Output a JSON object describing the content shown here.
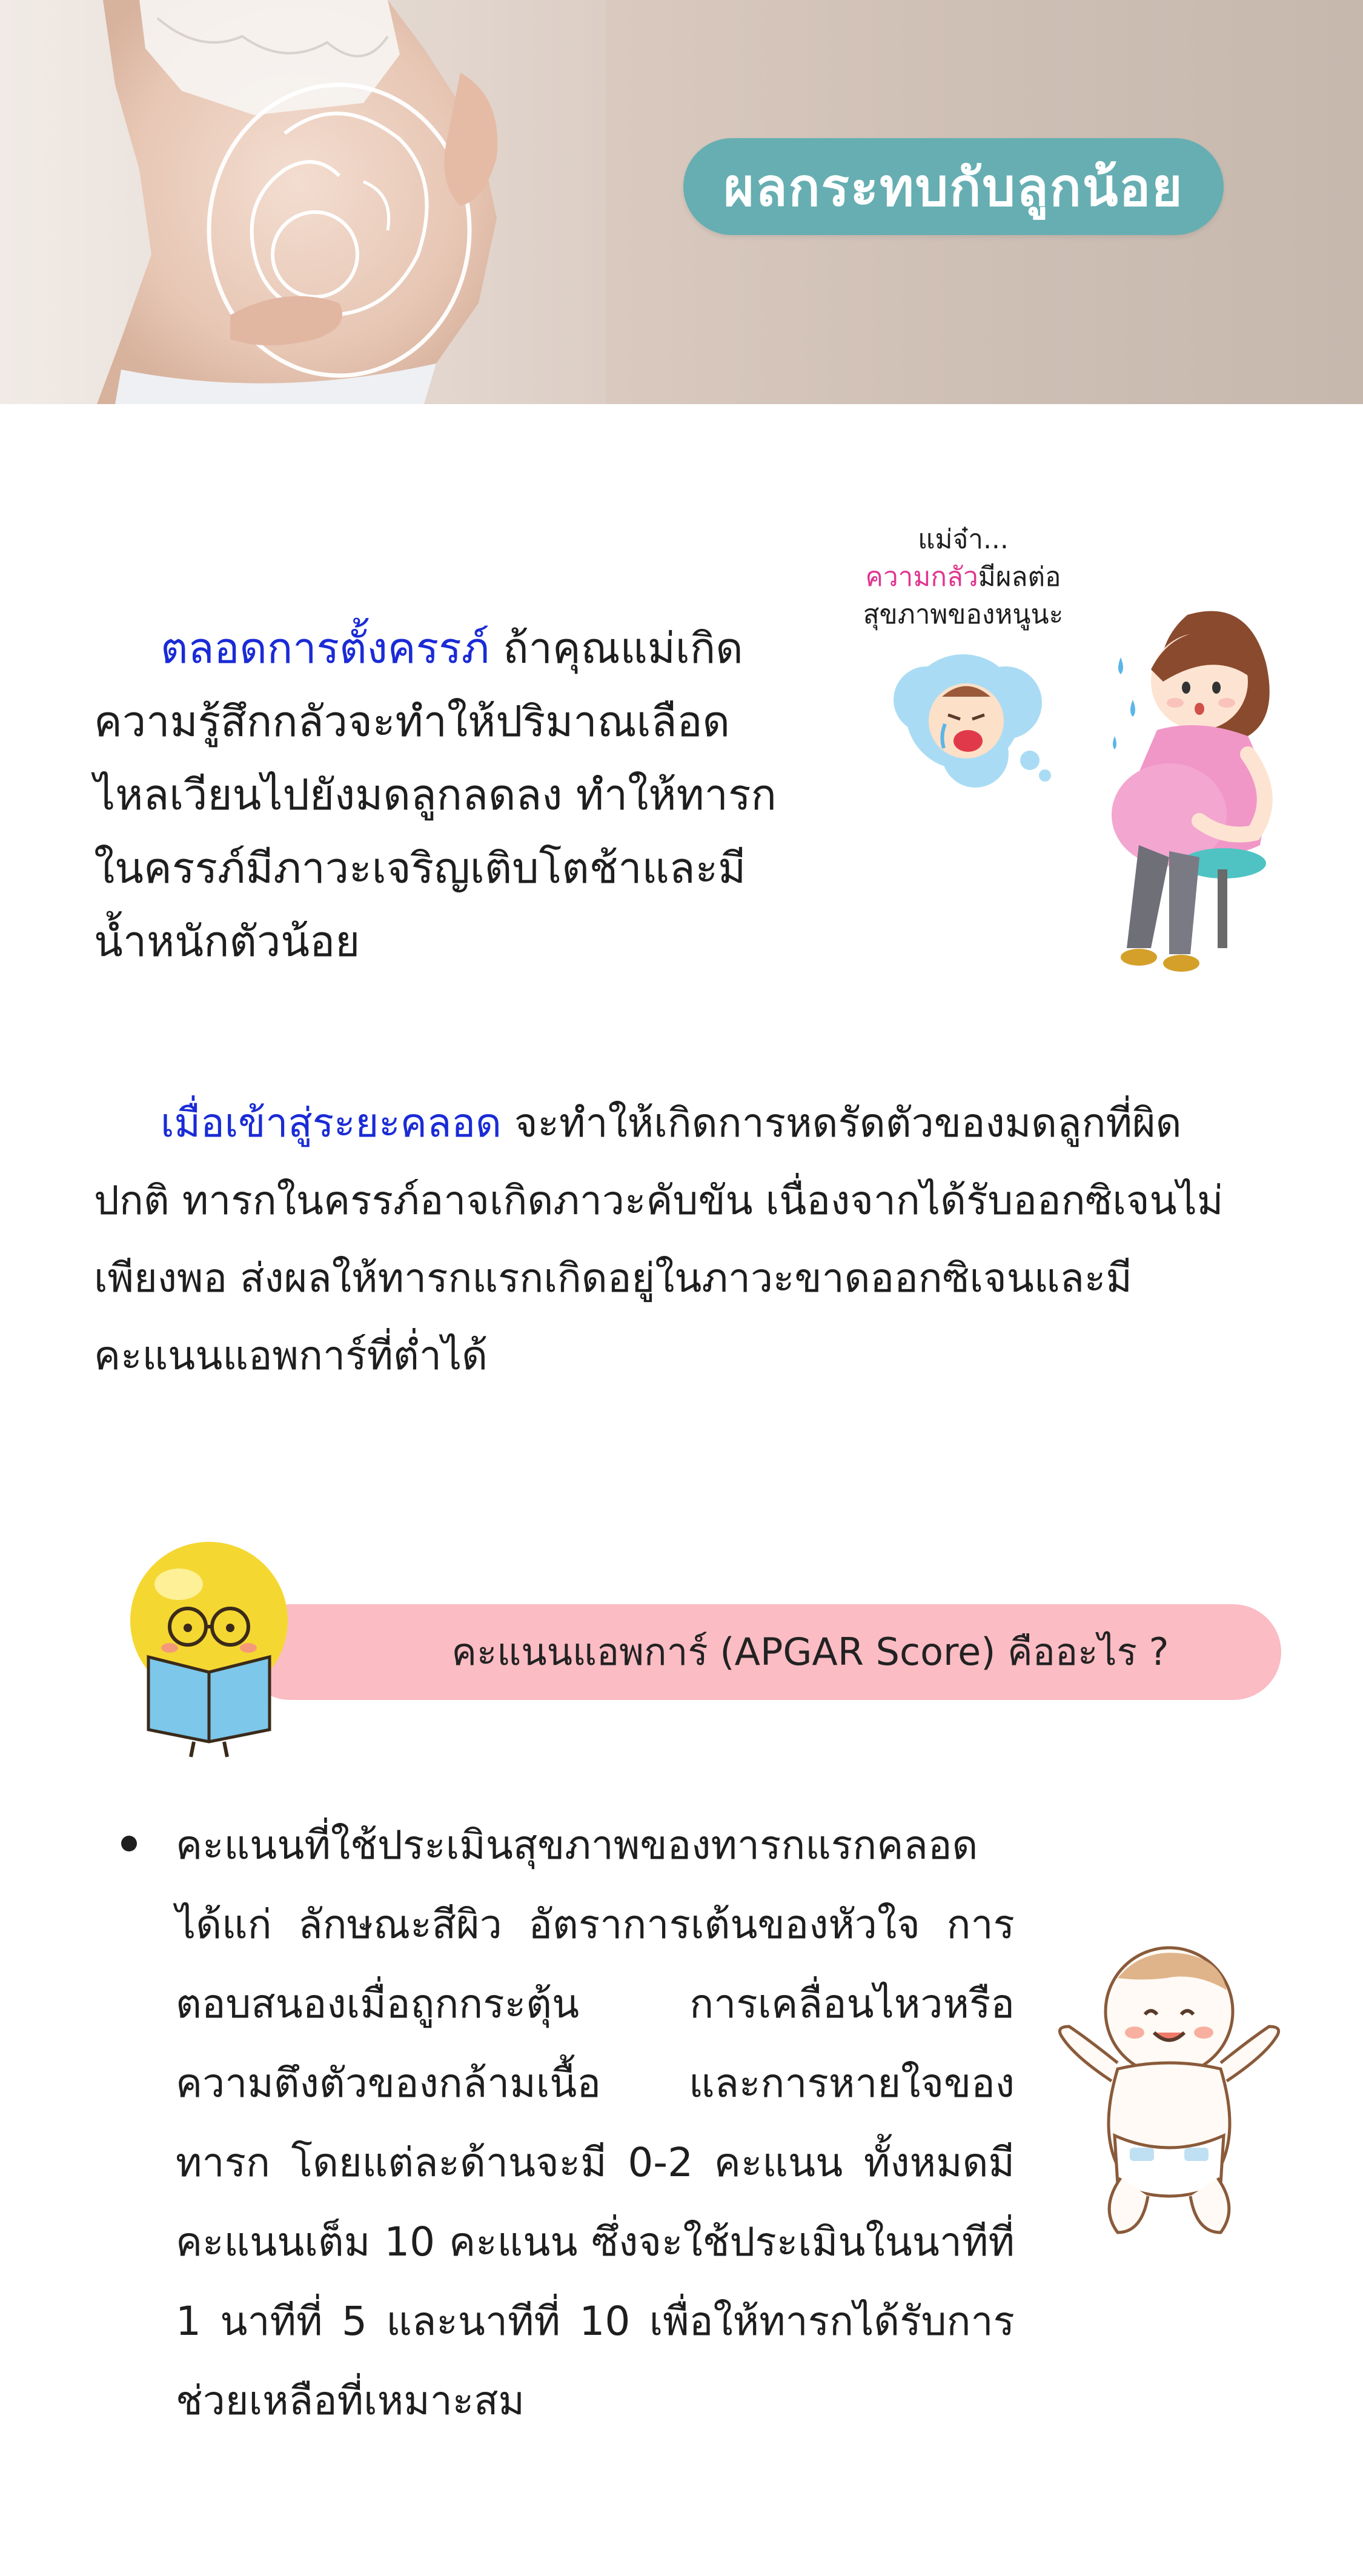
{
  "hero": {
    "title": "ผลกระทบกับลูกน้อย",
    "pill_color": "#66aeb2"
  },
  "section1": {
    "lead": "ตลอดการตั้งครรภ์",
    "text": " ถ้าคุณแม่เกิดความรู้สึกกลัวจะทำให้ปริมาณเลือดไหลเวียนไปยังมดลูกลดลง ทำให้ทารกในครรภ์มีภาวะเจริญเติบโตช้าและมีน้ำหนักตัวน้อย",
    "note": {
      "line1": "แม่จ๋า...",
      "highlight": "ความกลัว",
      "line2_rest": "มีผลต่อ",
      "line3": "สุขภาพของหนูนะ"
    }
  },
  "section2": {
    "lead": "เมื่อเข้าสู่ระยะคลอด",
    "text": " จะทำให้เกิดการหดรัดตัวของมดลูกที่ผิดปกติ ทารกในครรภ์อาจเกิดภาวะคับขัน เนื่องจากได้รับออกซิเจนไม่เพียงพอ ส่งผลให้ทารกแรกเกิดอยู่ในภาวะขาดออกซิเจนและมีคะแนนแอพการ์ที่ต่ำได้"
  },
  "section3": {
    "heading": "คะแนนแอพการ์ (APGAR Score) คืออะไร ?",
    "pill_color": "#fbbcc4",
    "bullet": "คะแนนที่ใช้ประเมินสุขภาพของทารกแรกคลอด ได้แก่ ลักษณะสีผิว อัตราการเต้นของหัวใจ การตอบสนองเมื่อถูกกระตุ้น การเคลื่อนไหวหรือความตึงตัวของกล้ามเนื้อ และการหายใจของทารก โดยแต่ละด้านจะมี 0-2 คะแนน ทั้งหมดมีคะแนนเต็ม 10 คะแนน ซึ่งจะใช้ประเมินในนาทีที่ 1 นาทีที่ 5 และนาทีที่ 10 เพื่อให้ทารกได้รับการช่วยเหลือที่เหมาะสม"
  },
  "accent_blue": "#1a2bd6",
  "accent_pink": "#e0368f",
  "icons": [
    "pregnant-belly-photo",
    "worried-mom-illustration",
    "crying-baby-thought-bubble",
    "lightbulb-reading-mascot",
    "happy-baby-illustration"
  ]
}
